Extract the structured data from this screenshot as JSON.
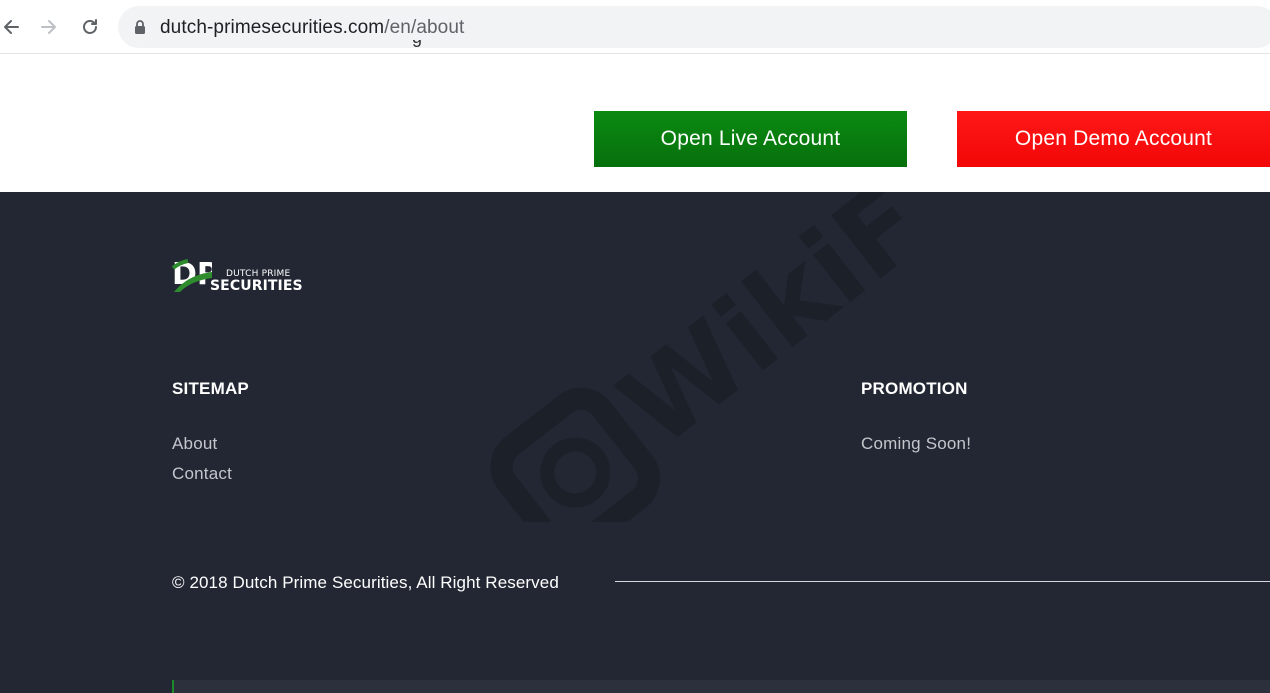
{
  "browser": {
    "url_host": "dutch-primesecurities.com",
    "url_path": "/en/about",
    "icons": [
      "back-arrow-icon",
      "forward-arrow-icon",
      "reload-icon",
      "lock-icon"
    ]
  },
  "cta": {
    "live_label": "Open Live Account",
    "demo_label": "Open Demo Account",
    "live_color": "#078010",
    "demo_color": "#fa0f0f"
  },
  "footer": {
    "background": "#222733",
    "logo": {
      "small": "DUTCH PRIME",
      "big": "SECURITIES",
      "monogram": "DP"
    },
    "sitemap": {
      "heading": "SITEMAP",
      "links": [
        "About",
        "Contact"
      ]
    },
    "promotion": {
      "heading": "PROMOTION",
      "text": "Coming Soon!"
    },
    "copyright": "© 2018 Dutch Prime Securities, All Right Reserved",
    "watermark_text": "WikiFX"
  }
}
